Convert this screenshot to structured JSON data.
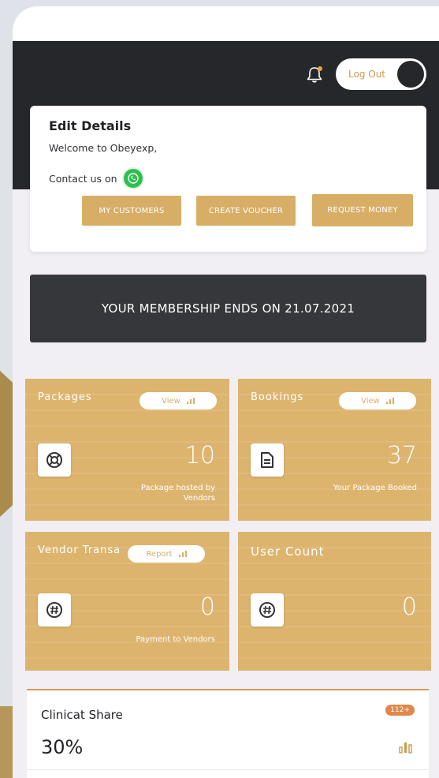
{
  "header": {
    "logout_label": "Log Out"
  },
  "details": {
    "title": "Edit Details",
    "welcome": "Welcome to Obeyexp,",
    "contact": "Contact us on",
    "buttons": [
      {
        "label": "MY CUSTOMERS"
      },
      {
        "label": "CREATE VOUCHER"
      },
      {
        "label": "REQUEST MONEY"
      }
    ]
  },
  "membership": {
    "text": "YOUR MEMBERSHIP ENDS ON 21.07.2021"
  },
  "stats": {
    "packages": {
      "title": "Packages",
      "pill": "View",
      "value": "10",
      "caption": "Package hosted by Vendors"
    },
    "bookings": {
      "title": "Bookings",
      "pill": "View",
      "value": "37",
      "caption": "Your Package Booked"
    },
    "vendor": {
      "title": "Vendor Transa",
      "pill": "Report",
      "value": "0",
      "caption": "Payment to Vendors"
    },
    "users": {
      "title": "User Count",
      "value": "0"
    }
  },
  "share": {
    "title": "Clinicat Share",
    "badge": "112+",
    "value": "30%"
  },
  "colors": {
    "gold": "#ddb46e",
    "dark": "#25272b",
    "banner": "#35373b",
    "whatsapp": "#2fbf4f",
    "badge": "#e0884a"
  },
  "icons": [
    "bell-icon",
    "whatsapp-icon",
    "bar-chart-icon",
    "lifebuoy-icon",
    "document-icon",
    "hashtag-icon"
  ]
}
